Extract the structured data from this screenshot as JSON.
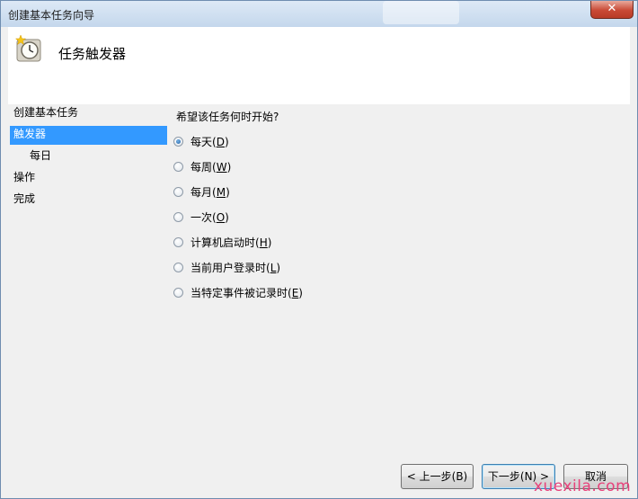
{
  "window": {
    "title": "创建基本任务向导",
    "close_label": "✕"
  },
  "header": {
    "icon": "task-clock-icon",
    "title": "任务触发器"
  },
  "sidebar": {
    "items": [
      {
        "label": "创建基本任务",
        "active": false
      },
      {
        "label": "触发器",
        "active": true
      },
      {
        "label": "每日",
        "active": false,
        "indent": true
      },
      {
        "label": "操作",
        "active": false
      },
      {
        "label": "完成",
        "active": false
      }
    ]
  },
  "main": {
    "question": "希望该任务何时开始?",
    "options": [
      {
        "label": "每天",
        "key": "D",
        "checked": true
      },
      {
        "label": "每周",
        "key": "W",
        "checked": false
      },
      {
        "label": "每月",
        "key": "M",
        "checked": false
      },
      {
        "label": "一次",
        "key": "O",
        "checked": false
      },
      {
        "label": "计算机启动时",
        "key": "H",
        "checked": false
      },
      {
        "label": "当前用户登录时",
        "key": "L",
        "checked": false
      },
      {
        "label": "当特定事件被记录时",
        "key": "E",
        "checked": false
      }
    ]
  },
  "footer": {
    "back_label": "< 上一步(B)",
    "next_label": "下一步(N) >",
    "cancel_label": "取消"
  },
  "watermark": "xuexila.com",
  "colors": {
    "selection": "#3399ff",
    "watermark": "#e8407a",
    "close_button": "#c94a36"
  }
}
